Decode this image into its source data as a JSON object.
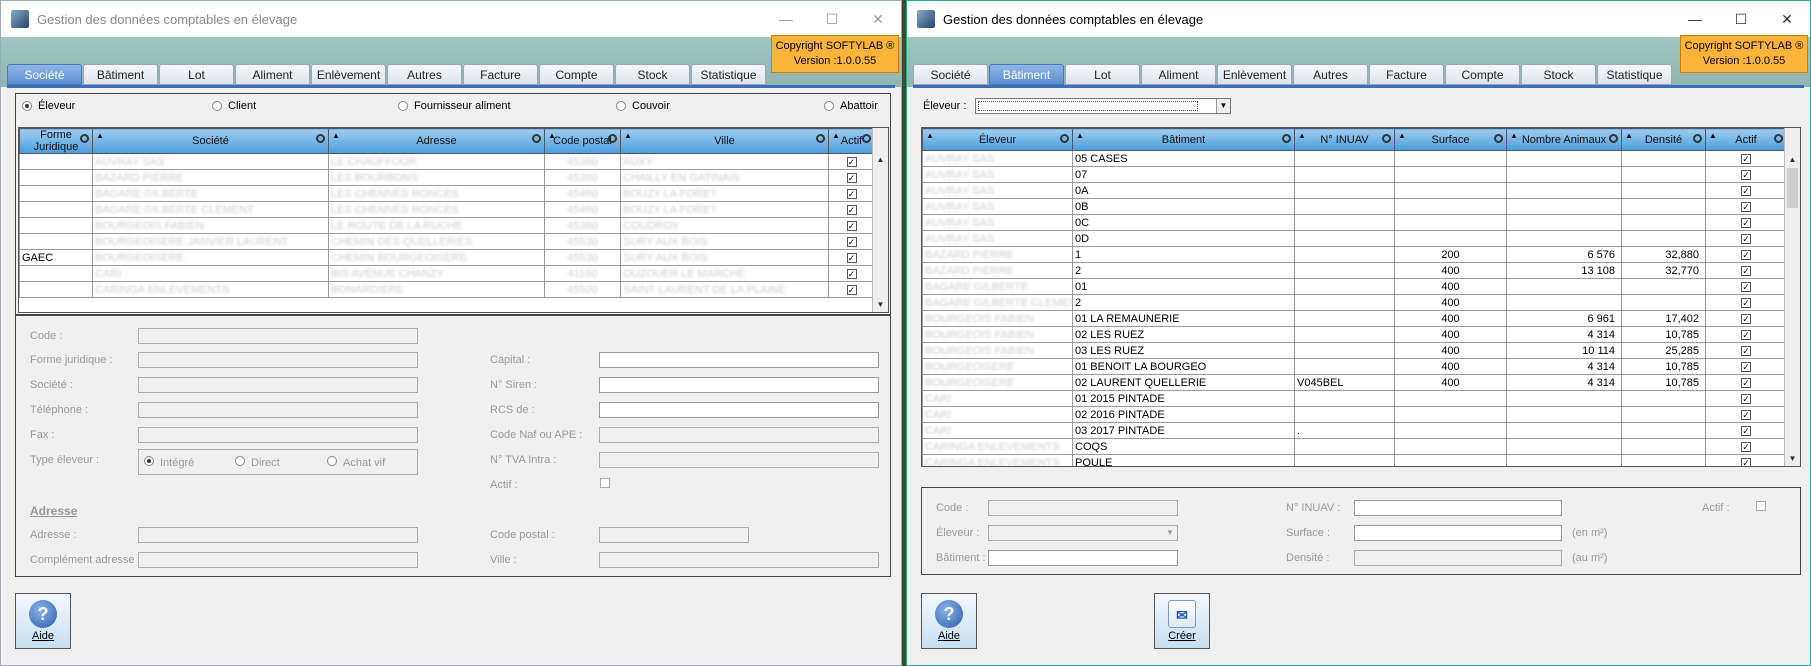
{
  "app": {
    "title": "Gestion des données comptables en élevage",
    "copyright": "Copyright SOFTYLAB ®",
    "version": "Version :1.0.0.55"
  },
  "tabs": [
    "Société",
    "Bâtiment",
    "Lot",
    "Aliment",
    "Enlèvement",
    "Autres",
    "Facture",
    "Compte",
    "Stock",
    "Statistique"
  ],
  "left": {
    "radios": [
      {
        "label": "Éleveur",
        "checked": true
      },
      {
        "label": "Client",
        "checked": false
      },
      {
        "label": "Fournisseur aliment",
        "checked": false
      },
      {
        "label": "Couvoir",
        "checked": false
      },
      {
        "label": "Abattoir",
        "checked": false
      }
    ],
    "columns": [
      "Forme Juridique",
      "Société",
      "Adresse",
      "Code postal",
      "Ville",
      "Actif"
    ],
    "rows": [
      {
        "forme": "",
        "societe": "AUVRAY SAS",
        "adresse": "LE CHAUFFOUR",
        "cp": "45360",
        "ville": "AUXY",
        "actif": true
      },
      {
        "forme": "",
        "societe": "BAZARD PIERRE",
        "adresse": "LES BOURBONS",
        "cp": "45390",
        "ville": "CHAILLY EN GATINAIS",
        "actif": true
      },
      {
        "forme": "",
        "societe": "BAGARE GILBERTE",
        "adresse": "LES CHENNES RONCES",
        "cp": "45460",
        "ville": "BOUZY LA FORET",
        "actif": true
      },
      {
        "forme": "",
        "societe": "BAGARE GILBERTE CLEMENT",
        "adresse": "LES CHENNES RONCES",
        "cp": "45460",
        "ville": "BOUZY LA FORET",
        "actif": true
      },
      {
        "forme": "",
        "societe": "BOURGEOIS FABIEN",
        "adresse": "LE ROUTE DE LA RUCHE",
        "cp": "45360",
        "ville": "COUDROY",
        "actif": true
      },
      {
        "forme": "",
        "societe": "BOURGEOISERE JANVIER LAURENT",
        "adresse": "CHEMIN DES QUELLERIES",
        "cp": "45530",
        "ville": "SURY AUX BOIS",
        "actif": true
      },
      {
        "forme": "GAEC",
        "societe": "BOURGEOISERE",
        "adresse": "CHEMIN BOURGEOISERE",
        "cp": "45530",
        "ville": "SURY AUX BOIS",
        "actif": true
      },
      {
        "forme": "",
        "societe": "CARI",
        "adresse": "BIS AVENUE CHANZY",
        "cp": "41160",
        "ville": "OUZOUER LE MARCHE",
        "actif": true
      },
      {
        "forme": "",
        "societe": "CARINGA ENLEVEMENTS",
        "adresse": "BONARDIERE",
        "cp": "45520",
        "ville": "SAINT LAURENT DE LA PLAINE",
        "actif": true
      }
    ],
    "form": {
      "code": "Code :",
      "forme": "Forme juridique :",
      "societe": "Société :",
      "telephone": "Téléphone :",
      "fax": "Fax :",
      "type": "Type éleveur :",
      "type_options": [
        "Intégré",
        "Direct",
        "Achat vif"
      ],
      "capital": "Capital :",
      "siren": "N° Siren :",
      "rcs": "RCS de :",
      "naf": "Code Naf ou APE :",
      "tva": "N° TVA Intra :",
      "actif": "Actif :",
      "adresse_section": "Adresse",
      "adresse": "Adresse :",
      "complement": "Complément adresse :",
      "cp": "Code postal :",
      "ville": "Ville :"
    },
    "aide": "Aide"
  },
  "right": {
    "eleveur_label": "Éleveur :",
    "columns": [
      "Éleveur",
      "Bâtiment",
      "N° INUAV",
      "Surface",
      "Nombre Animaux",
      "Densité",
      "Actif"
    ],
    "rows": [
      {
        "eleveur": "AUVRAY SAS",
        "batiment": "05 CASES",
        "inuav": "",
        "surface": "",
        "animaux": "",
        "densite": "",
        "actif": true
      },
      {
        "eleveur": "AUVRAY SAS",
        "batiment": "07",
        "inuav": "",
        "surface": "",
        "animaux": "",
        "densite": "",
        "actif": true
      },
      {
        "eleveur": "AUVRAY SAS",
        "batiment": "0A",
        "inuav": "",
        "surface": "",
        "animaux": "",
        "densite": "",
        "actif": true
      },
      {
        "eleveur": "AUVRAY SAS",
        "batiment": "0B",
        "inuav": "",
        "surface": "",
        "animaux": "",
        "densite": "",
        "actif": true
      },
      {
        "eleveur": "AUVRAY SAS",
        "batiment": "0C",
        "inuav": "",
        "surface": "",
        "animaux": "",
        "densite": "",
        "actif": true
      },
      {
        "eleveur": "AUVRAY SAS",
        "batiment": "0D",
        "inuav": "",
        "surface": "",
        "animaux": "",
        "densite": "",
        "actif": true
      },
      {
        "eleveur": "BAZARD PIERRE",
        "batiment": "1",
        "inuav": "",
        "surface": "200",
        "animaux": "6 576",
        "densite": "32,880",
        "actif": true
      },
      {
        "eleveur": "BAZARD PIERRE",
        "batiment": "2",
        "inuav": "",
        "surface": "400",
        "animaux": "13 108",
        "densite": "32,770",
        "actif": true
      },
      {
        "eleveur": "BAGARE GILBERTE",
        "batiment": "01",
        "inuav": "",
        "surface": "400",
        "animaux": "",
        "densite": "",
        "actif": true
      },
      {
        "eleveur": "BAGARE GILBERTE CLEMEN",
        "batiment": "2",
        "inuav": "",
        "surface": "400",
        "animaux": "",
        "densite": "",
        "actif": true
      },
      {
        "eleveur": "BOURGEOIS FABIEN",
        "batiment": "01   LA REMAUNERIE",
        "inuav": "",
        "surface": "400",
        "animaux": "6 961",
        "densite": "17,402",
        "actif": true
      },
      {
        "eleveur": "BOURGEOIS FABIEN",
        "batiment": "02  LES RUEZ",
        "inuav": "",
        "surface": "400",
        "animaux": "4 314",
        "densite": "10,785",
        "actif": true
      },
      {
        "eleveur": "BOURGEOIS FABIEN",
        "batiment": "03  LES RUEZ",
        "inuav": "",
        "surface": "400",
        "animaux": "10 114",
        "densite": "25,285",
        "actif": true
      },
      {
        "eleveur": "BOURGEOISERE",
        "batiment": "01 BENOIT LA BOURGEO",
        "inuav": "",
        "surface": "400",
        "animaux": "4 314",
        "densite": "10,785",
        "actif": true
      },
      {
        "eleveur": "BOURGEOISERE",
        "batiment": "02 LAURENT QUELLERIE",
        "inuav": "V045BEL",
        "surface": "400",
        "animaux": "4 314",
        "densite": "10,785",
        "actif": true
      },
      {
        "eleveur": "CARI",
        "batiment": "01 2015 PINTADE",
        "inuav": "",
        "surface": "",
        "animaux": "",
        "densite": "",
        "actif": true
      },
      {
        "eleveur": "CARI",
        "batiment": "02 2016 PINTADE",
        "inuav": "",
        "surface": "",
        "animaux": "",
        "densite": "",
        "actif": true
      },
      {
        "eleveur": "CARI",
        "batiment": "03 2017 PINTADE",
        "inuav": ".",
        "surface": "",
        "animaux": "",
        "densite": "",
        "actif": true
      },
      {
        "eleveur": "CARINGA ENLEVEMENTS",
        "batiment": "COQS",
        "inuav": "",
        "surface": "",
        "animaux": "",
        "densite": "",
        "actif": true
      },
      {
        "eleveur": "CARINGA ENLEVEMENTS",
        "batiment": "POULE",
        "inuav": "",
        "surface": "",
        "animaux": "",
        "densite": "",
        "actif": true
      }
    ],
    "form": {
      "code": "Code :",
      "eleveur": "Éleveur :",
      "batiment": "Bâtiment :",
      "inuav": "N° INUAV :",
      "surface": "Surface :",
      "densite": "Densité :",
      "actif": "Actif :",
      "unit_m2": "(en m²)",
      "unit_au": "(au m²)"
    },
    "aide": "Aide",
    "creer": "Créer"
  }
}
